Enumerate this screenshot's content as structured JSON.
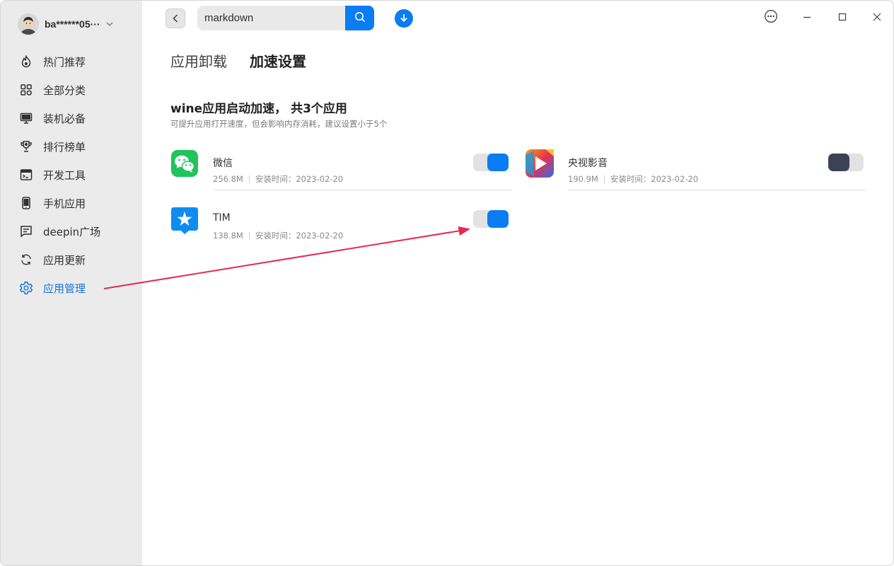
{
  "user": {
    "name": "ba******05···"
  },
  "sidebar": {
    "items": [
      {
        "label": "热门推荐",
        "icon": "flame-icon"
      },
      {
        "label": "全部分类",
        "icon": "grid-icon"
      },
      {
        "label": "装机必备",
        "icon": "monitor-icon"
      },
      {
        "label": "排行榜单",
        "icon": "trophy-icon"
      },
      {
        "label": "开发工具",
        "icon": "terminal-icon"
      },
      {
        "label": "手机应用",
        "icon": "phone-icon"
      },
      {
        "label": "deepin广场",
        "icon": "chat-icon"
      },
      {
        "label": "应用更新",
        "icon": "refresh-icon"
      },
      {
        "label": "应用管理",
        "icon": "gear-icon",
        "active": true
      }
    ]
  },
  "toolbar": {
    "search_value": "markdown"
  },
  "tabs": [
    {
      "label": "应用卸载"
    },
    {
      "label": "加速设置",
      "active": true
    }
  ],
  "section": {
    "title": "wine应用启动加速， 共3个应用",
    "subtitle": "可提升应用打开速度，但会影响内存消耗，建议设置小于5个"
  },
  "apps": [
    {
      "name": "微信",
      "size": "256.8M",
      "install": "安装时间：2023-02-20",
      "enabled": true
    },
    {
      "name": "央视影音",
      "size": "190.9M",
      "install": "安装时间：2023-02-20",
      "enabled": false
    },
    {
      "name": "TIM",
      "size": "138.8M",
      "install": "安装时间：2023-02-20",
      "enabled": true
    }
  ],
  "colors": {
    "accent": "#0a7cf4",
    "annotation_arrow": "#e8284f"
  }
}
